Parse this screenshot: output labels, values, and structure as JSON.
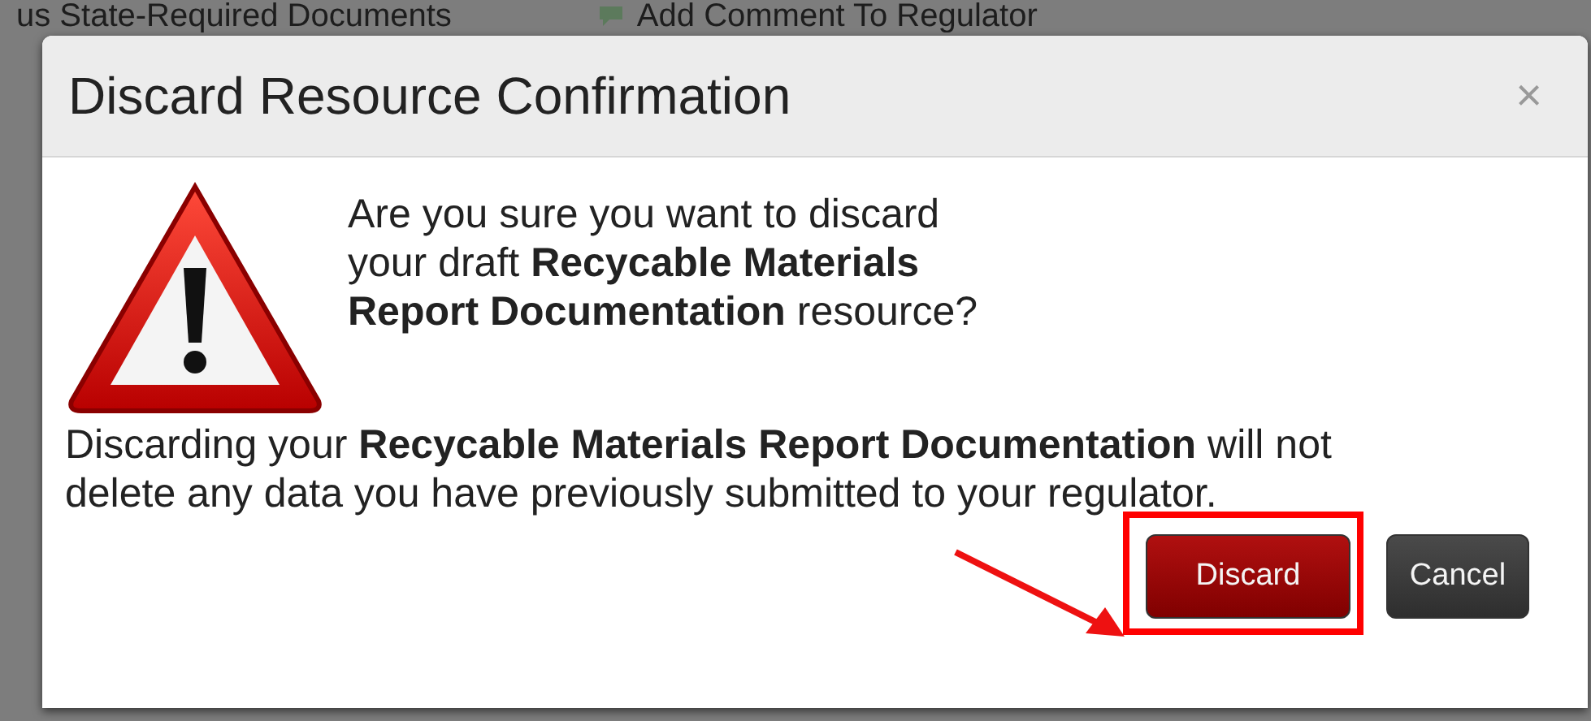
{
  "background": {
    "toolbar_items": [
      {
        "label": "us State-Required Documents",
        "kind": "text"
      },
      {
        "label": "Add Comment To Regulator",
        "kind": "icon"
      }
    ]
  },
  "dialog": {
    "title": "Discard Resource Confirmation",
    "close": "×",
    "question": "Are you sure you want to discard your draft **Recycable Materials Report Documentation** resource?",
    "note": "Discarding your **Recycable Materials Report Documentation** will not delete any data you have previously submitted to your regulator.",
    "buttons": [
      {
        "label": "Discard",
        "kind": "primary",
        "highlighted": true
      },
      {
        "label": "Cancel",
        "kind": "secondary",
        "highlighted": false
      }
    ]
  }
}
